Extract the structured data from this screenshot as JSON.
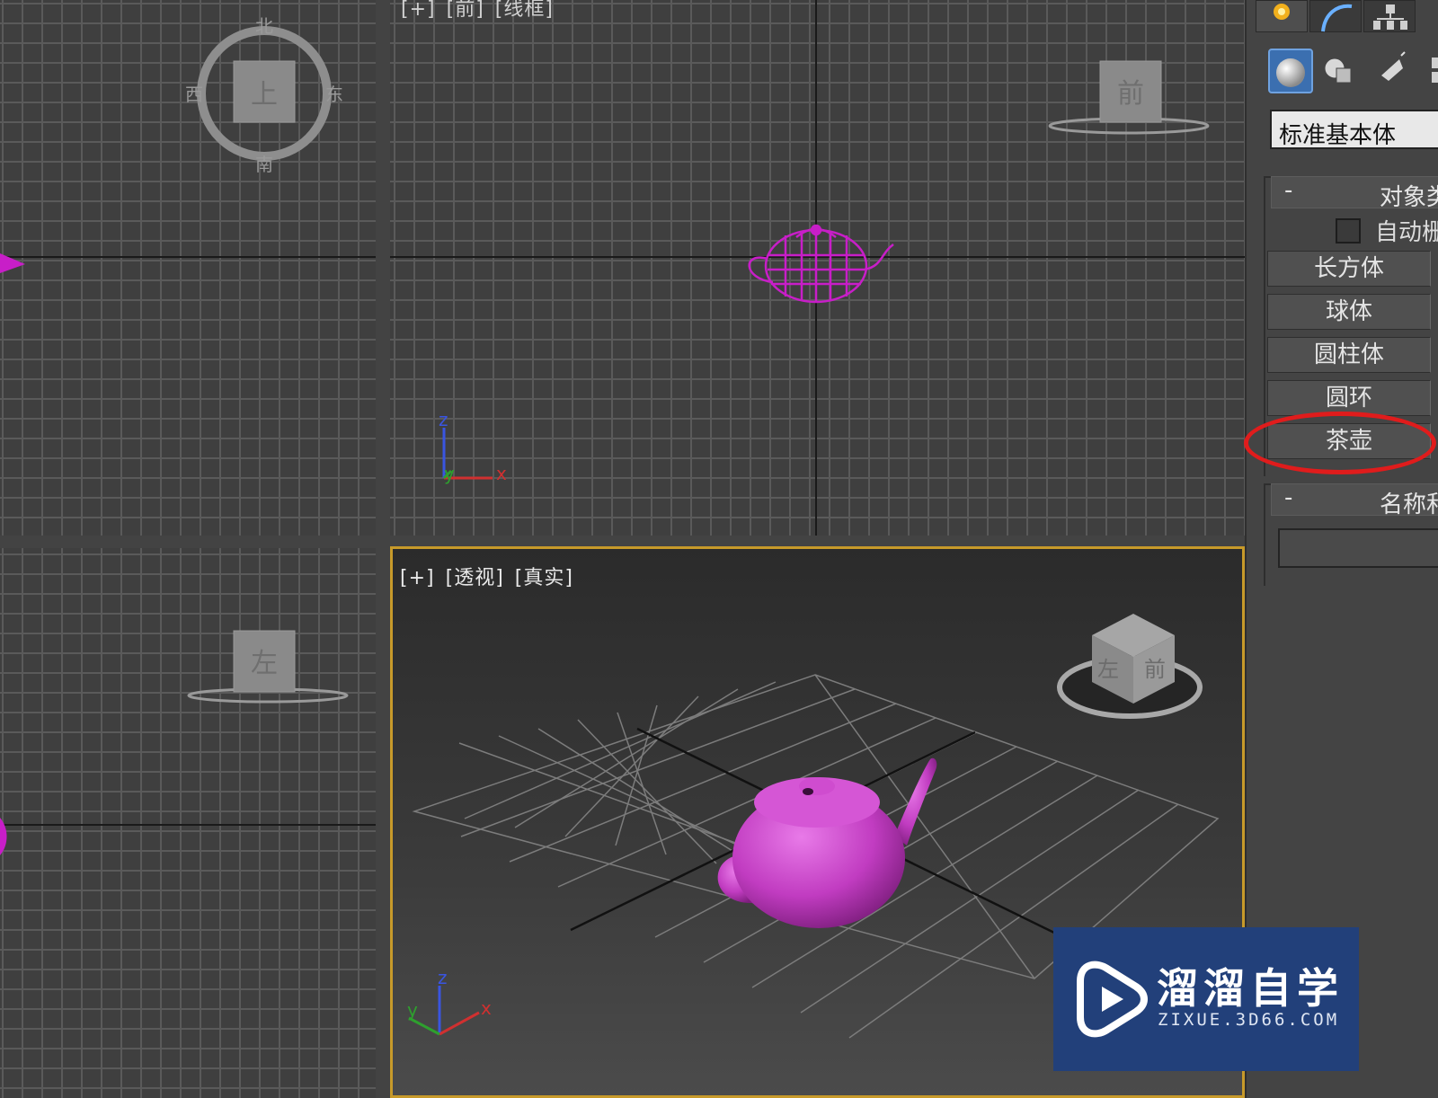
{
  "viewports": {
    "front": {
      "plus": "[+]",
      "view": "[前]",
      "shading": "[线框]"
    },
    "perspective": {
      "plus": "[+]",
      "view": "[透视]",
      "shading": "[真实]"
    }
  },
  "viewcube": {
    "top": {
      "face": "上",
      "north": "北",
      "south": "南",
      "east": "东",
      "west": "西"
    },
    "front": {
      "face": "前"
    },
    "left": {
      "face": "左"
    },
    "perspective": {
      "face_left": "左",
      "face_front": "前"
    }
  },
  "axes": {
    "x": "x",
    "y": "y",
    "z": "z"
  },
  "command_panel": {
    "tabs": [
      "create-icon",
      "modify-icon",
      "hierarchy-icon"
    ],
    "subtabs": [
      "geometry-icon",
      "shapes-icon",
      "lights-icon",
      "cameras-icon"
    ],
    "category_dropdown": "标准基本体",
    "object_type_rollout": {
      "minus": "-",
      "title": "对象类"
    },
    "autogrid_label": "自动栅",
    "buttons": [
      "长方体",
      "球体",
      "圆柱体",
      "圆环",
      "茶壶"
    ],
    "highlighted_button": "茶壶",
    "name_color_rollout": {
      "minus": "-",
      "title": "名称和"
    }
  },
  "colors": {
    "teapot": "#c13cc1",
    "wireframe": "#c81ec8",
    "highlight": "#e01c1c",
    "active_border": "#c79a2a",
    "watermark_bg": "#22407a"
  },
  "watermark": {
    "title": "溜溜自学",
    "subtitle": "ZIXUE.3D66.COM"
  }
}
